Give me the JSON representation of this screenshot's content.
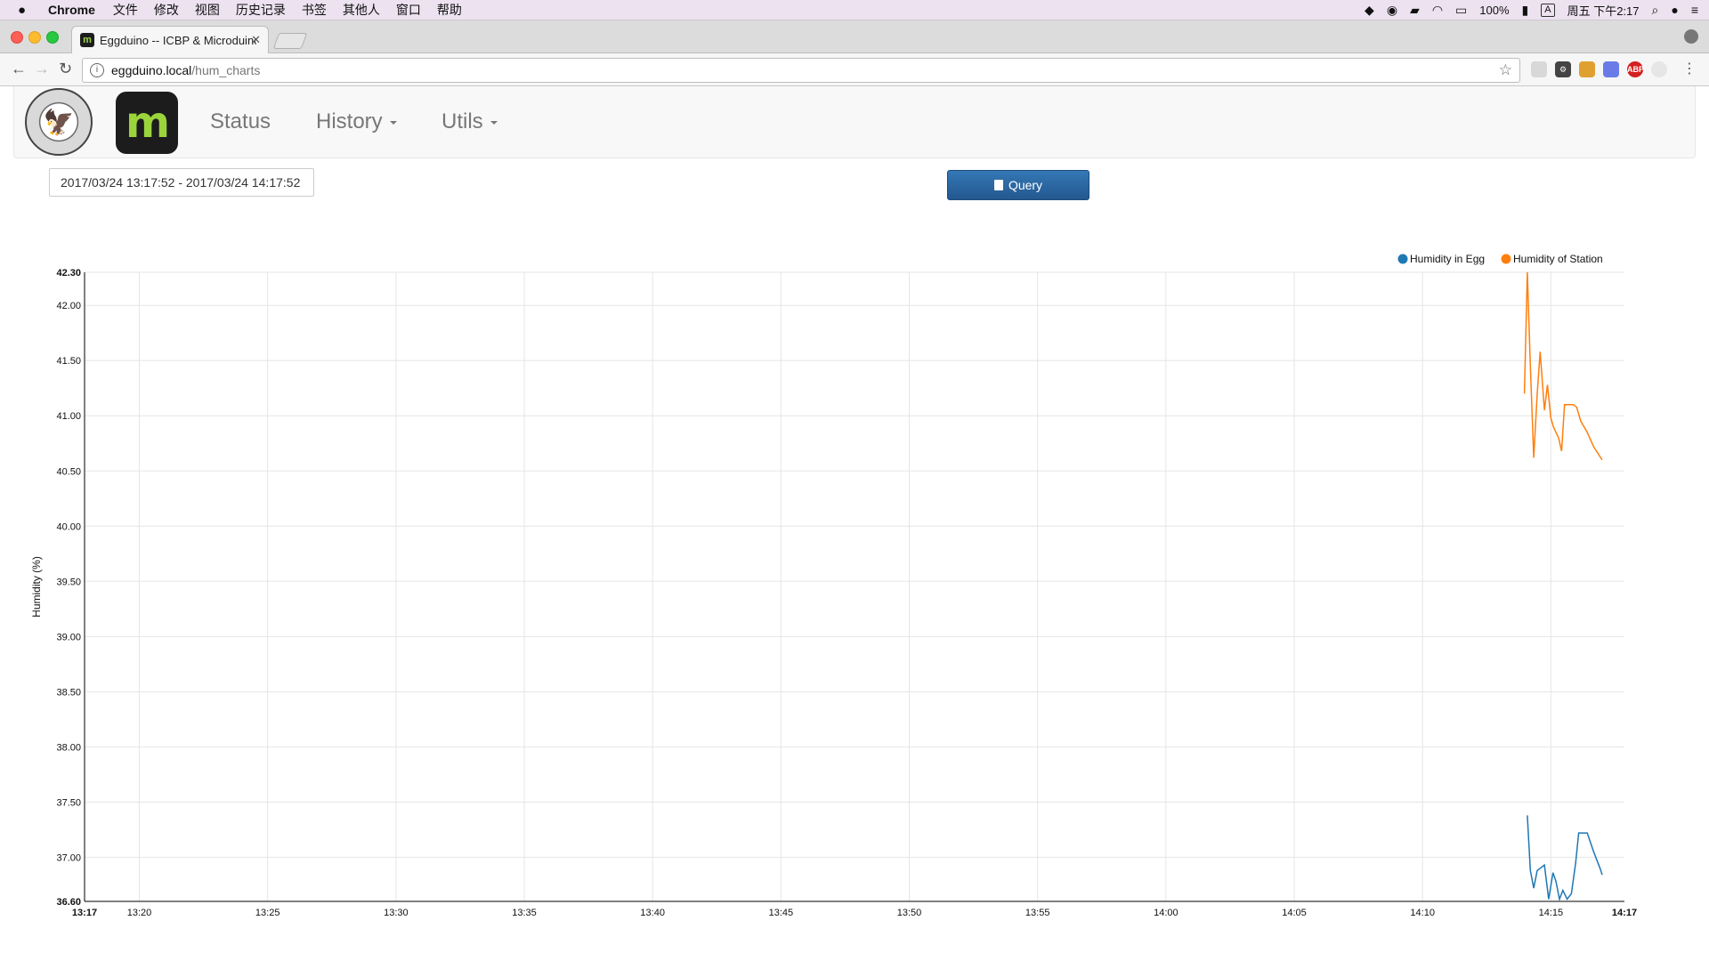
{
  "os_menubar": {
    "app_name": "Chrome",
    "menus": [
      "文件",
      "修改",
      "视图",
      "历史记录",
      "书签",
      "其他人",
      "窗口",
      "帮助"
    ],
    "battery": "100%",
    "input_method": "A",
    "clock": "周五 下午2:17"
  },
  "browser": {
    "tab_title": "Eggduino -- ICBP & Microduino",
    "url_host": "eggduino.local",
    "url_path": "/hum_charts"
  },
  "app_nav": {
    "links": [
      {
        "label": "Status",
        "dropdown": false
      },
      {
        "label": "History",
        "dropdown": true
      },
      {
        "label": "Utils",
        "dropdown": true
      }
    ]
  },
  "controls": {
    "date_range": "2017/03/24 13:17:52 - 2017/03/24 14:17:52",
    "query_label": "Query"
  },
  "chart_data": {
    "type": "line",
    "ylabel": "Humidity (%)",
    "ylim": [
      36.6,
      42.3
    ],
    "y_ticks": [
      "36.60",
      "37.00",
      "37.50",
      "38.00",
      "38.50",
      "39.00",
      "39.50",
      "40.00",
      "40.50",
      "41.00",
      "41.50",
      "42.00",
      "42.30"
    ],
    "x_ticks": [
      "13:17",
      "13:20",
      "13:25",
      "13:30",
      "13:35",
      "13:40",
      "13:45",
      "13:50",
      "13:55",
      "14:00",
      "14:05",
      "14:10",
      "14:15",
      "14:17"
    ],
    "grid": true,
    "legend_position": "top-right",
    "series": [
      {
        "name": "Humidity in Egg",
        "color": "#1f77b4",
        "x": [
          "14:14:05",
          "14:14:12",
          "14:14:20",
          "14:14:28",
          "14:14:35",
          "14:14:45",
          "14:14:55",
          "14:15:05",
          "14:15:12",
          "14:15:20",
          "14:15:28",
          "14:15:38",
          "14:15:48",
          "14:15:58",
          "14:16:05",
          "14:16:15",
          "14:16:25",
          "14:16:40",
          "14:16:55",
          "14:17:00"
        ],
        "y": [
          37.38,
          36.88,
          36.72,
          36.88,
          36.9,
          36.93,
          36.62,
          36.86,
          36.78,
          36.62,
          36.7,
          36.62,
          36.67,
          36.95,
          37.22,
          37.22,
          37.22,
          37.05,
          36.9,
          36.84
        ]
      },
      {
        "name": "Humidity of Station",
        "color": "#ff7f0e",
        "x": [
          "14:13:58",
          "14:14:05",
          "14:14:12",
          "14:14:20",
          "14:14:28",
          "14:14:35",
          "14:14:45",
          "14:14:52",
          "14:15:00",
          "14:15:06",
          "14:15:12",
          "14:15:18",
          "14:15:25",
          "14:15:32",
          "14:15:38",
          "14:15:45",
          "14:15:52",
          "14:16:00",
          "14:16:10",
          "14:16:25",
          "14:16:40",
          "14:17:00"
        ],
        "y": [
          41.2,
          42.3,
          41.45,
          40.62,
          41.2,
          41.58,
          41.05,
          41.28,
          40.98,
          40.9,
          40.85,
          40.8,
          40.68,
          41.1,
          41.1,
          41.1,
          41.1,
          41.08,
          40.95,
          40.85,
          40.72,
          40.6
        ]
      }
    ]
  }
}
